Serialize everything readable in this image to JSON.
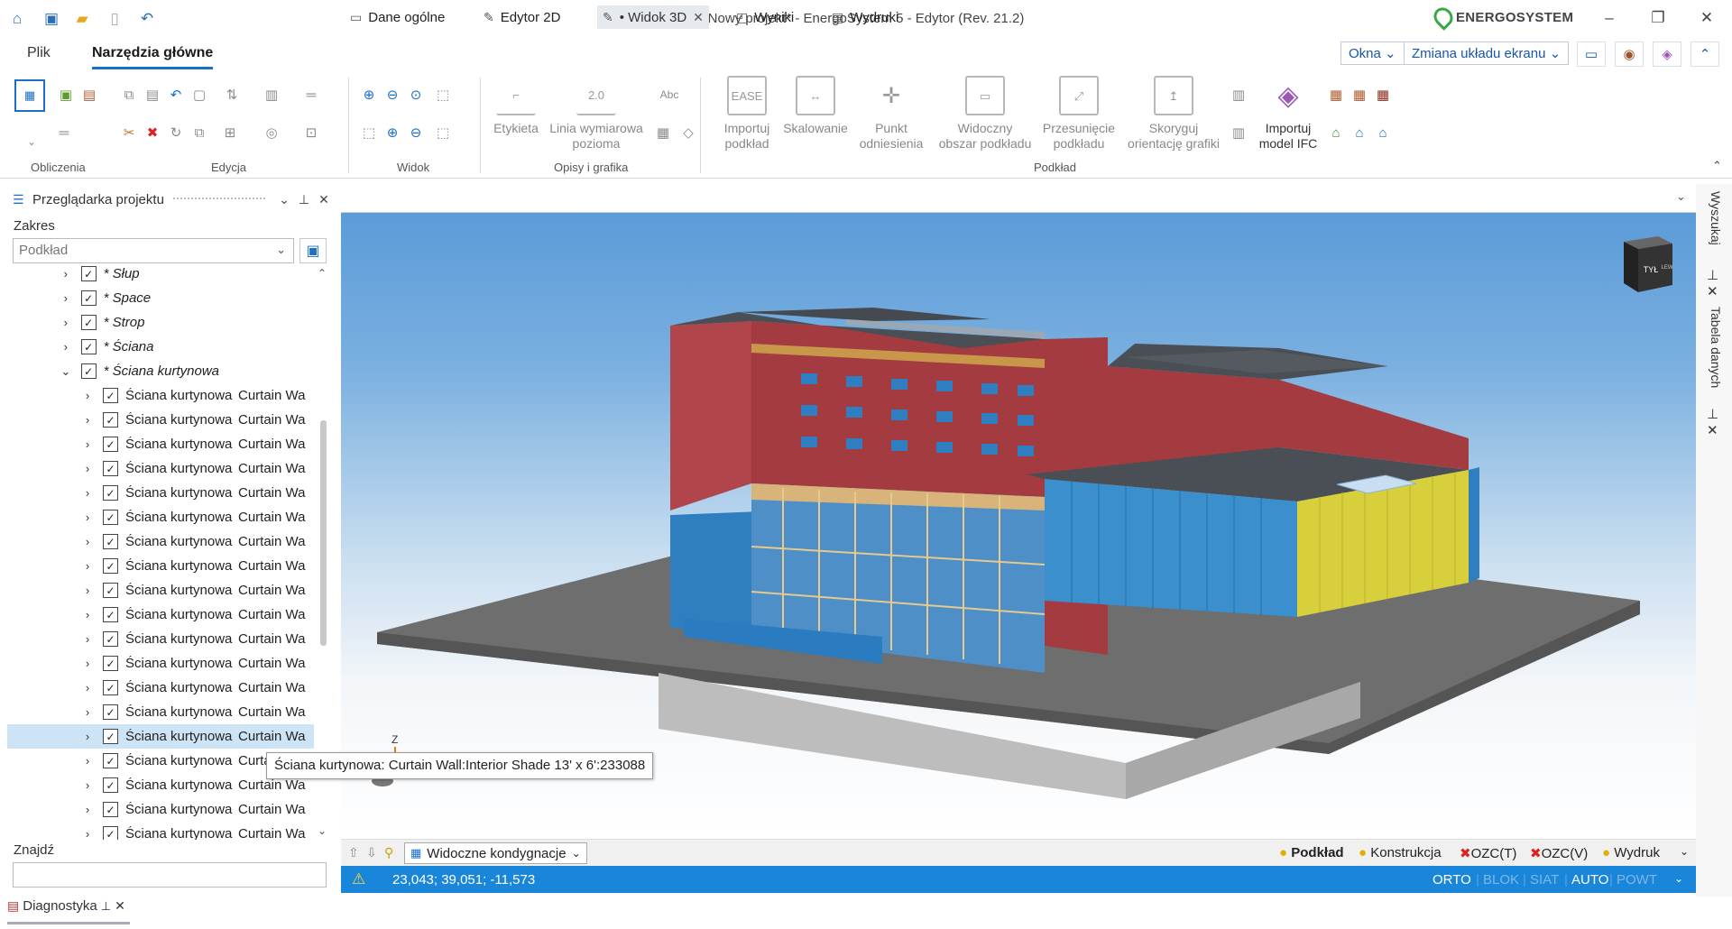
{
  "window": {
    "title": "Nowy projekt* - EnergoSystem 5 - Edytor (Rev. 21.2)",
    "brand": "ENERGOSYSTEM"
  },
  "menu": {
    "tabs": [
      {
        "label": "Plik"
      },
      {
        "label": "Narzędzia główne"
      }
    ],
    "okna_label": "Okna",
    "layout_label": "Zmiana układu ekranu"
  },
  "ribbon": {
    "groups": {
      "obliczenia": "Obliczenia",
      "edycja": "Edycja",
      "widok": "Widok",
      "opisy": "Opisy i grafika",
      "podklad": "Podkład"
    },
    "buttons": {
      "etykieta": "Etykieta",
      "linia1": "Linia wymiarowa",
      "linia2": "pozioma",
      "abc": "Abc",
      "dim": "2.0",
      "importuj1": "Importuj",
      "importuj2": "podkład",
      "skalowanie": "Skalowanie",
      "punkt1": "Punkt",
      "punkt2": "odniesienia",
      "widoczny1": "Widoczny",
      "widoczny2": "obszar podkładu",
      "przesun1": "Przesunięcie",
      "przesun2": "podkładu",
      "skoryguj1": "Skoryguj",
      "skoryguj2": "orientację grafiki",
      "ifc1": "Importuj",
      "ifc2": "model IFC",
      "ease": "EASE"
    }
  },
  "left_panel": {
    "title": "Przeglądarka projektu",
    "zakres_label": "Zakres",
    "zakres_value": "Podkład",
    "find_label": "Znajdź",
    "diagnostics_label": "Diagnostyka",
    "tree": [
      {
        "label": "* Słup",
        "level": 0
      },
      {
        "label": "* Space",
        "level": 0
      },
      {
        "label": "* Strop",
        "level": 0
      },
      {
        "label": "* Ściana",
        "level": 0
      },
      {
        "label": "* Ściana kurtynowa",
        "level": 0,
        "expanded": true
      },
      {
        "label": "Ściana kurtynowa",
        "label2": "Curtain Wa",
        "level": 1
      },
      {
        "label": "Ściana kurtynowa",
        "label2": "Curtain Wa",
        "level": 1
      },
      {
        "label": "Ściana kurtynowa",
        "label2": "Curtain Wa",
        "level": 1
      },
      {
        "label": "Ściana kurtynowa",
        "label2": "Curtain Wa",
        "level": 1
      },
      {
        "label": "Ściana kurtynowa",
        "label2": "Curtain Wa",
        "level": 1
      },
      {
        "label": "Ściana kurtynowa",
        "label2": "Curtain Wa",
        "level": 1
      },
      {
        "label": "Ściana kurtynowa",
        "label2": "Curtain Wa",
        "level": 1
      },
      {
        "label": "Ściana kurtynowa",
        "label2": "Curtain Wa",
        "level": 1
      },
      {
        "label": "Ściana kurtynowa",
        "label2": "Curtain Wa",
        "level": 1
      },
      {
        "label": "Ściana kurtynowa",
        "label2": "Curtain Wa",
        "level": 1
      },
      {
        "label": "Ściana kurtynowa",
        "label2": "Curtain Wa",
        "level": 1
      },
      {
        "label": "Ściana kurtynowa",
        "label2": "Curtain Wa",
        "level": 1
      },
      {
        "label": "Ściana kurtynowa",
        "label2": "Curtain Wa",
        "level": 1
      },
      {
        "label": "Ściana kurtynowa",
        "label2": "Curtain Wa",
        "level": 1
      },
      {
        "label": "Ściana kurtynowa",
        "label2": "Curtain Wa",
        "level": 1,
        "selected": true
      },
      {
        "label": "Ściana kurtynowa",
        "label2": "Curtain Wa",
        "level": 1
      },
      {
        "label": "Ściana kurtynowa",
        "label2": "Curtain Wa",
        "level": 1
      },
      {
        "label": "Ściana kurtynowa",
        "label2": "Curtain Wa",
        "level": 1
      },
      {
        "label": "Ściana kurtynowa",
        "label2": "Curtain Wa",
        "level": 1
      }
    ]
  },
  "tooltip": "Ściana kurtynowa: Curtain Wall:Interior Shade 13' x 6':233088",
  "doc_tabs": [
    {
      "label": "Dane ogólne"
    },
    {
      "label": "Edytor 2D"
    },
    {
      "label": "• Widok 3D",
      "active": true
    },
    {
      "label": "Wyniki"
    },
    {
      "label": "Wydruki"
    }
  ],
  "viewport": {
    "navcube_front": "TYŁ",
    "navcube_side": "LEW",
    "axis_label": "Z"
  },
  "view_bar": {
    "filter_label": "Widoczne kondygnacje",
    "layers": [
      {
        "label": "Podkład",
        "bold": true
      },
      {
        "label": "Konstrukcja"
      },
      {
        "label": "OZC(T)"
      },
      {
        "label": "OZC(V)"
      },
      {
        "label": "Wydruk"
      }
    ]
  },
  "status": {
    "coords": "23,043; 39,051; -11,573",
    "modes": [
      {
        "label": "ORTO",
        "on": true
      },
      {
        "label": "BLOK",
        "on": false
      },
      {
        "label": "SIAT",
        "on": false
      },
      {
        "label": "AUTO",
        "on": true
      },
      {
        "label": "POWT",
        "on": false
      }
    ]
  },
  "right_side": {
    "tabs": [
      {
        "label": "Wyszukaj"
      },
      {
        "label": "Tabela danych"
      }
    ]
  },
  "colors": {
    "accent": "#1a86d9",
    "selection": "#cde4f7",
    "brand_green": "#38a845"
  }
}
